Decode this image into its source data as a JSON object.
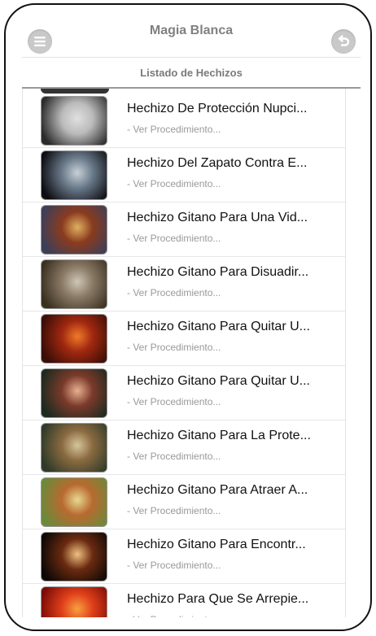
{
  "header": {
    "title": "Magia Blanca",
    "menu_icon": "menu-icon",
    "back_icon": "back-arrow-icon"
  },
  "subheader": {
    "title": "Listado de Hechizos"
  },
  "list": {
    "items": [
      {
        "title": "Hechizo De Protección Nupci...",
        "subtitle": "- Ver Procedimiento...",
        "thumb": [
          "#2a2a2a",
          "#bbbbbb",
          "#e0e0e0"
        ]
      },
      {
        "title": "Hechizo Del Zapato Contra E...",
        "subtitle": "- Ver Procedimiento...",
        "thumb": [
          "#0d0d12",
          "#6a7a8a",
          "#c8d0d8"
        ]
      },
      {
        "title": "Hechizo Gitano Para Una Vid...",
        "subtitle": "- Ver Procedimiento...",
        "thumb": [
          "#3b3f5a",
          "#8a3b1f",
          "#e0b060"
        ]
      },
      {
        "title": "Hechizo Gitano Para Disuadir...",
        "subtitle": "- Ver Procedimiento...",
        "thumb": [
          "#3a3020",
          "#8a7a66",
          "#cfc6b5"
        ]
      },
      {
        "title": "Hechizo Gitano Para Quitar U...",
        "subtitle": "- Ver Procedimiento...",
        "thumb": [
          "#3a0d06",
          "#a02810",
          "#f07a2a"
        ]
      },
      {
        "title": "Hechizo Gitano Para Quitar U...",
        "subtitle": "- Ver Procedimiento...",
        "thumb": [
          "#1c2a20",
          "#7a3a2a",
          "#e8b090"
        ]
      },
      {
        "title": "Hechizo Gitano Para La Prote...",
        "subtitle": "- Ver Procedimiento...",
        "thumb": [
          "#2f3a2a",
          "#8a6a40",
          "#d6c59a"
        ]
      },
      {
        "title": "Hechizo Gitano Para Atraer A...",
        "subtitle": "- Ver Procedimiento...",
        "thumb": [
          "#6a8a3a",
          "#b86a30",
          "#e8d890"
        ]
      },
      {
        "title": "Hechizo Gitano Para Encontr...",
        "subtitle": "- Ver Procedimiento...",
        "thumb": [
          "#0d0806",
          "#6a2a10",
          "#f0c080"
        ]
      },
      {
        "title": "Hechizo Para Que Se Arrepie...",
        "subtitle": "- Ver Procedimiento...",
        "thumb": [
          "#7a0a06",
          "#e0401a",
          "#f8a040"
        ]
      }
    ]
  }
}
